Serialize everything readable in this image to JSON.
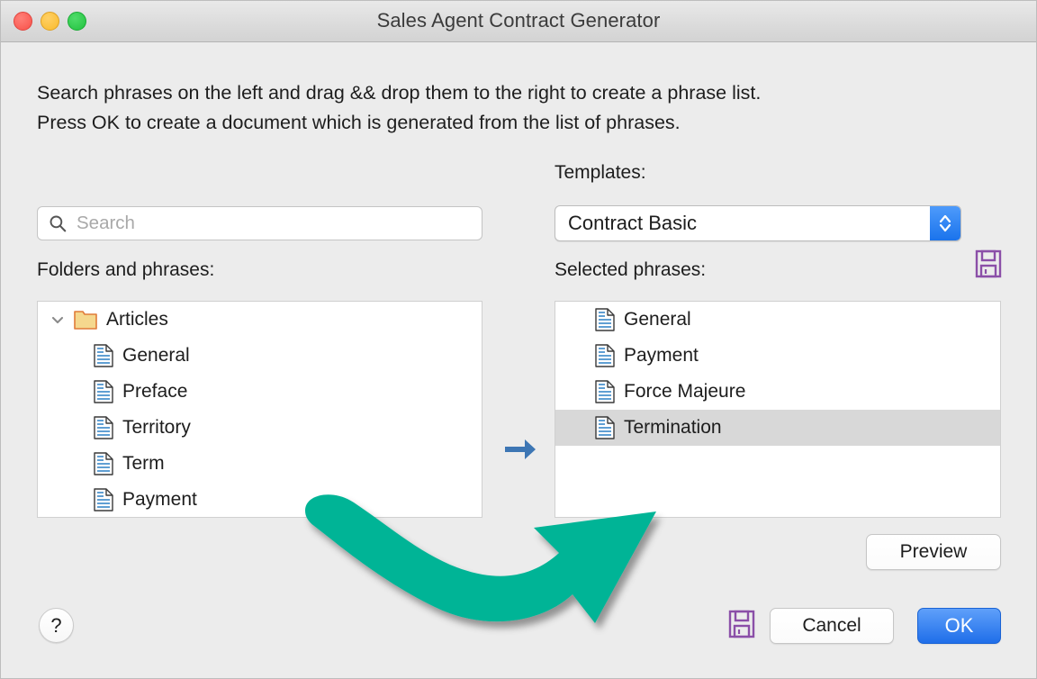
{
  "window": {
    "title": "Sales Agent Contract Generator",
    "traffic_lights": [
      "close-button",
      "minimize-button",
      "maximize-button"
    ],
    "colors": {
      "close": "#f85149",
      "minimize": "#f9bb2d",
      "maximize": "#23c23f",
      "accent_blue": "#1f6ee9",
      "annotation_teal": "#00b496",
      "save_icon_purple": "#8b4fa8",
      "folder_orange": "#e07b39",
      "folder_fill": "#f5d88e",
      "doc_line_blue": "#2a7fc4",
      "trash_brown": "#6b3a2a",
      "selected_row": "#d8d8d8"
    }
  },
  "intro": {
    "line1": "Search phrases on the left and drag && drop them to the right to create a phrase list.",
    "line2": "Press OK to create a document which is generated from the list of phrases."
  },
  "search": {
    "placeholder": "Search",
    "value": "",
    "icon": "search-icon"
  },
  "left_panel": {
    "label": "Folders and phrases:",
    "tree": [
      {
        "label": "Articles",
        "type": "folder",
        "icon": "folder-icon",
        "expanded": true,
        "chevron": "chevron-down-icon"
      },
      {
        "label": "General",
        "type": "phrase",
        "icon": "document-icon"
      },
      {
        "label": "Preface",
        "type": "phrase",
        "icon": "document-icon"
      },
      {
        "label": "Territory",
        "type": "phrase",
        "icon": "document-icon"
      },
      {
        "label": "Term",
        "type": "phrase",
        "icon": "document-icon"
      },
      {
        "label": "Payment",
        "type": "phrase",
        "icon": "document-icon"
      }
    ]
  },
  "middle": {
    "arrow_icon": "arrow-right-icon"
  },
  "templates": {
    "label": "Templates:",
    "selected": "Contract Basic",
    "options": [
      "Contract Basic"
    ],
    "stepper_icon": "stepper-updown-icon",
    "save_icon": "save-template-icon"
  },
  "right_panel": {
    "label": "Selected phrases:",
    "phrases": [
      {
        "label": "General",
        "icon": "document-icon",
        "selected": false
      },
      {
        "label": "Payment",
        "icon": "document-icon",
        "selected": false
      },
      {
        "label": "Force Majeure",
        "icon": "document-icon",
        "selected": false
      },
      {
        "label": "Termination",
        "icon": "document-icon",
        "selected": true
      }
    ],
    "trash_icon": "trash-icon",
    "preview_label": "Preview"
  },
  "footer": {
    "help_label": "?",
    "save_icon": "save-list-icon",
    "cancel_label": "Cancel",
    "ok_label": "OK"
  },
  "annotation": {
    "type": "curved-arrow",
    "color": "#00b496",
    "description": "drag and drop gesture from folders list to selected phrases list"
  }
}
